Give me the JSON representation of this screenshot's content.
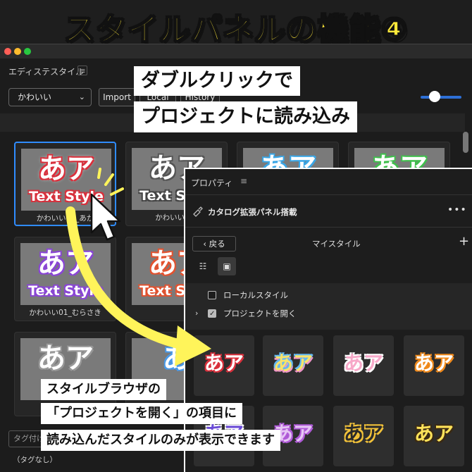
{
  "banner": {
    "title": "スタイルパネルの機能④"
  },
  "window": {
    "panel_title": "エディステスタイル",
    "menu_glyph": "≡",
    "select": {
      "value": "かわいい",
      "chevron": "⌄"
    },
    "tabs": [
      {
        "label": "Import"
      },
      {
        "label": "Local"
      },
      {
        "label": "History"
      }
    ],
    "tag_placeholder": "タグ付け",
    "no_tag": "（タグなし）",
    "cards": [
      {
        "big": "あア",
        "small": "Text Style",
        "caption": "かわいい01_あか",
        "big_color": "#ffffff",
        "stroke": "#d9303c"
      },
      {
        "big": "あア",
        "small": "Text Style",
        "caption": "かわいい01_",
        "big_color": "#ffffff",
        "stroke": "#555555"
      },
      {
        "big": "あア",
        "small": "",
        "caption": "",
        "big_color": "#ffffff",
        "stroke": "#3aa6e6"
      },
      {
        "big": "あア",
        "small": "",
        "caption": "",
        "big_color": "#ffffff",
        "stroke": "#3fbf4c"
      },
      {
        "big": "あア",
        "small": "Text Style",
        "caption": "かわいい01_むらさき",
        "big_color": "#ffffff",
        "stroke": "#8a45d6"
      },
      {
        "big": "あア",
        "small": "Text Style",
        "caption": "",
        "big_color": "#ffffff",
        "stroke": "#e3522f"
      },
      {
        "big": "あア",
        "small": "Text S",
        "caption": "",
        "big_color": "#ffffff",
        "stroke": "#999999"
      },
      {
        "big": "あ",
        "small": "",
        "caption": "",
        "big_color": "#ffffff",
        "stroke": "#4a9ae8"
      }
    ]
  },
  "callouts": {
    "top_line1": "ダブルクリックで",
    "top_line2": "プロジェクトに読み込み",
    "bottom_line1": "スタイルブラウザの",
    "bottom_line2": "「プロジェクトを開く」の項目に",
    "bottom_line3": "読み込んだスタイルのみが表示できます"
  },
  "properties": {
    "title": "プロパティ",
    "menu_glyph": "≡",
    "header": "カタログ拡張パネル搭載",
    "header_icon": "brush-icon",
    "more": "•••",
    "back": "‹  戻る",
    "my_style": "マイスタイル",
    "plus": "+",
    "list_view_glyph": "☷",
    "grid_view_glyph": "▣",
    "rows": [
      {
        "label": "ローカルスタイル",
        "checked": false,
        "expandable": false
      },
      {
        "label": "プロジェクトを開く",
        "checked": true,
        "expandable": true
      }
    ],
    "tiles": [
      {
        "text": "あア",
        "color": "#ffffff",
        "stroke": "#d9303c"
      },
      {
        "text": "あア",
        "color": "#f8e36a",
        "stroke": "#63b8f0"
      },
      {
        "text": "あア",
        "color": "#f7a8c8",
        "stroke": "#ffffff"
      },
      {
        "text": "あア",
        "color": "#ffffff",
        "stroke": "#f08a1c"
      },
      {
        "text": "あア",
        "color": "#6a4bd6",
        "stroke": "#ffffff"
      },
      {
        "text": "あア",
        "color": "#e6c6f4",
        "stroke": "#b05ad8"
      },
      {
        "text": "あア",
        "color": "#2a2a2a",
        "stroke": "#f2c23a"
      },
      {
        "text": "あア",
        "color": "#ffe35a",
        "stroke": "#3a2a14"
      }
    ]
  }
}
